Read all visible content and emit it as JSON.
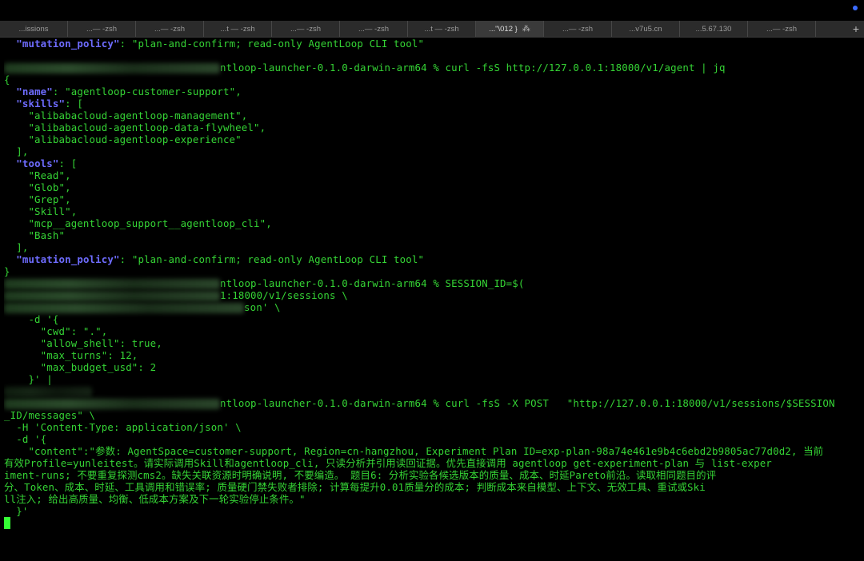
{
  "window": {
    "status_dot_color": "#3b6cff"
  },
  "tabs": [
    {
      "label": "...issions"
    },
    {
      "label": "...— -zsh"
    },
    {
      "label": "...— -zsh"
    },
    {
      "label": "...t — -zsh"
    },
    {
      "label": "...— -zsh"
    },
    {
      "label": "...— -zsh"
    },
    {
      "label": "...t — -zsh"
    },
    {
      "label": "...\"\\012 }",
      "active": true
    },
    {
      "label": "...— -zsh"
    },
    {
      "label": "...v7u5.cn"
    },
    {
      "label": "...5.67.130"
    },
    {
      "label": "...— -zsh"
    }
  ],
  "tab_add_label": "+",
  "terminal": {
    "line_01": "  \"mutation_policy\": \"plan-and-confirm; read-only AgentLoop CLI tool\"",
    "line_03": "ntloop-launcher-0.1.0-darwin-arm64 % curl -fsS http://127.0.0.1:18000/v1/agent | jq",
    "line_04": "{",
    "line_05": "  \"name\": \"agentloop-customer-support\",",
    "line_06": "  \"skills\": [",
    "line_07": "    \"alibabacloud-agentloop-management\",",
    "line_08": "    \"alibabacloud-agentloop-data-flywheel\",",
    "line_09": "    \"alibabacloud-agentloop-experience\"",
    "line_10": "  ],",
    "line_11": "  \"tools\": [",
    "line_12": "    \"Read\",",
    "line_13": "    \"Glob\",",
    "line_14": "    \"Grep\",",
    "line_15": "    \"Skill\",",
    "line_16": "    \"mcp__agentloop_support__agentloop_cli\",",
    "line_17": "    \"Bash\"",
    "line_18": "  ],",
    "line_19": "  \"mutation_policy\": \"plan-and-confirm; read-only AgentLoop CLI tool\"",
    "line_20": "}",
    "line_21": "ntloop-launcher-0.1.0-darwin-arm64 % SESSION_ID=$(",
    "line_22": "1:18000/v1/sessions \\",
    "line_23": "son' \\",
    "line_24": "    -d '{",
    "line_25": "      \"cwd\": \".\",",
    "line_26": "      \"allow_shell\": true,",
    "line_27": "      \"max_turns\": 12,",
    "line_28": "      \"max_budget_usd\": 2",
    "line_29": "    }' |",
    "line_31": "ntloop-launcher-0.1.0-darwin-arm64 % curl -fsS -X POST   \"http://127.0.0.1:18000/v1/sessions/$SESSION",
    "line_32": "_ID/messages\" \\",
    "line_33": "  -H 'Content-Type: application/json' \\",
    "line_34": "  -d '{",
    "line_35": "    \"content\":\"参数: AgentSpace=customer-support, Region=cn-hangzhou, Experiment Plan ID=exp-plan-98a74e461e9b4c6ebd2b9805ac77d0d2, 当前",
    "line_36": "有效Profile=yunleitest。请实际调用Skill和agentloop_cli, 只读分析并引用读回证据。优先直接调用 agentloop get-experiment-plan 与 list-exper",
    "line_37": "iment-runs; 不要重复探测cms2。缺失关联资源时明确说明, 不要编造。 题目6: 分析实验各候选版本的质量、成本、时延Pareto前沿。读取相同题目的评",
    "line_38": "分、Token、成本、时延、工具调用和错误率; 质量硬门禁失败者排除; 计算每提升0.01质量分的成本; 判断成本来自模型、上下文、无效工具、重试或Ski",
    "line_39": "ll注入; 给出高质量、均衡、低成本方案及下一轮实验停止条件。\"",
    "line_40": "  }'"
  }
}
